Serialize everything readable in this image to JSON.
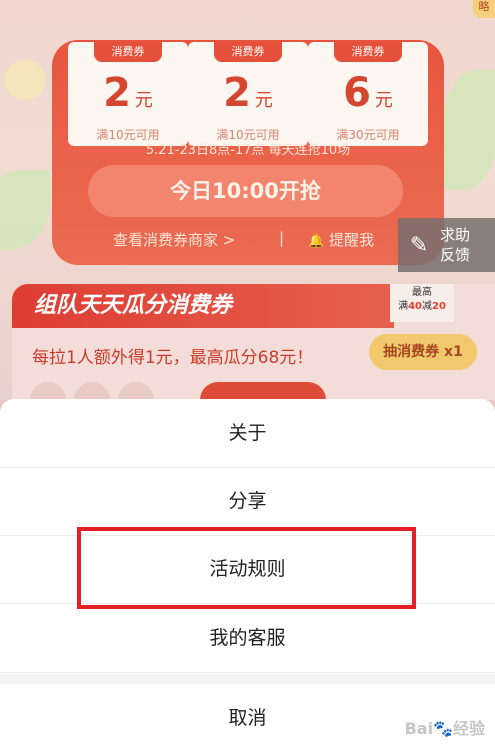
{
  "coupons": [
    {
      "tag": "消费券",
      "amount": "2",
      "unit": "元",
      "condition": "满10元可用"
    },
    {
      "tag": "消费券",
      "amount": "2",
      "unit": "元",
      "condition": "满10元可用"
    },
    {
      "tag": "消费券",
      "amount": "6",
      "unit": "元",
      "condition": "满30元可用"
    }
  ],
  "panel": {
    "schedule": "5.21-23日8点-17点 每天连抢10场",
    "grab_button": "今日10:00开抢",
    "merchants_link": "查看消费券商家 >",
    "divider": "|",
    "remind_link": "提醒我",
    "bell_icon": "🔔",
    "corner_tag": "略"
  },
  "help": {
    "line1": "求助",
    "line2": "反馈",
    "icon": "✎"
  },
  "team": {
    "title": "组队天天瓜分消费券",
    "description": "每拉1人额外得1元，最高瓜分68元！",
    "badge_line1": "最高",
    "badge_line2_prefix": "满",
    "badge_line2_num": "40",
    "badge_line2_mid": "减",
    "badge_line2_num2": "20",
    "lottery_button": "抽消费券 x1"
  },
  "sheet": {
    "items": [
      "关于",
      "分享",
      "活动规则",
      "我的客服"
    ],
    "cancel": "取消",
    "watermark": "Bai🐾经验"
  },
  "colors": {
    "highlight": "#e51f24",
    "accent": "#e8553f"
  }
}
